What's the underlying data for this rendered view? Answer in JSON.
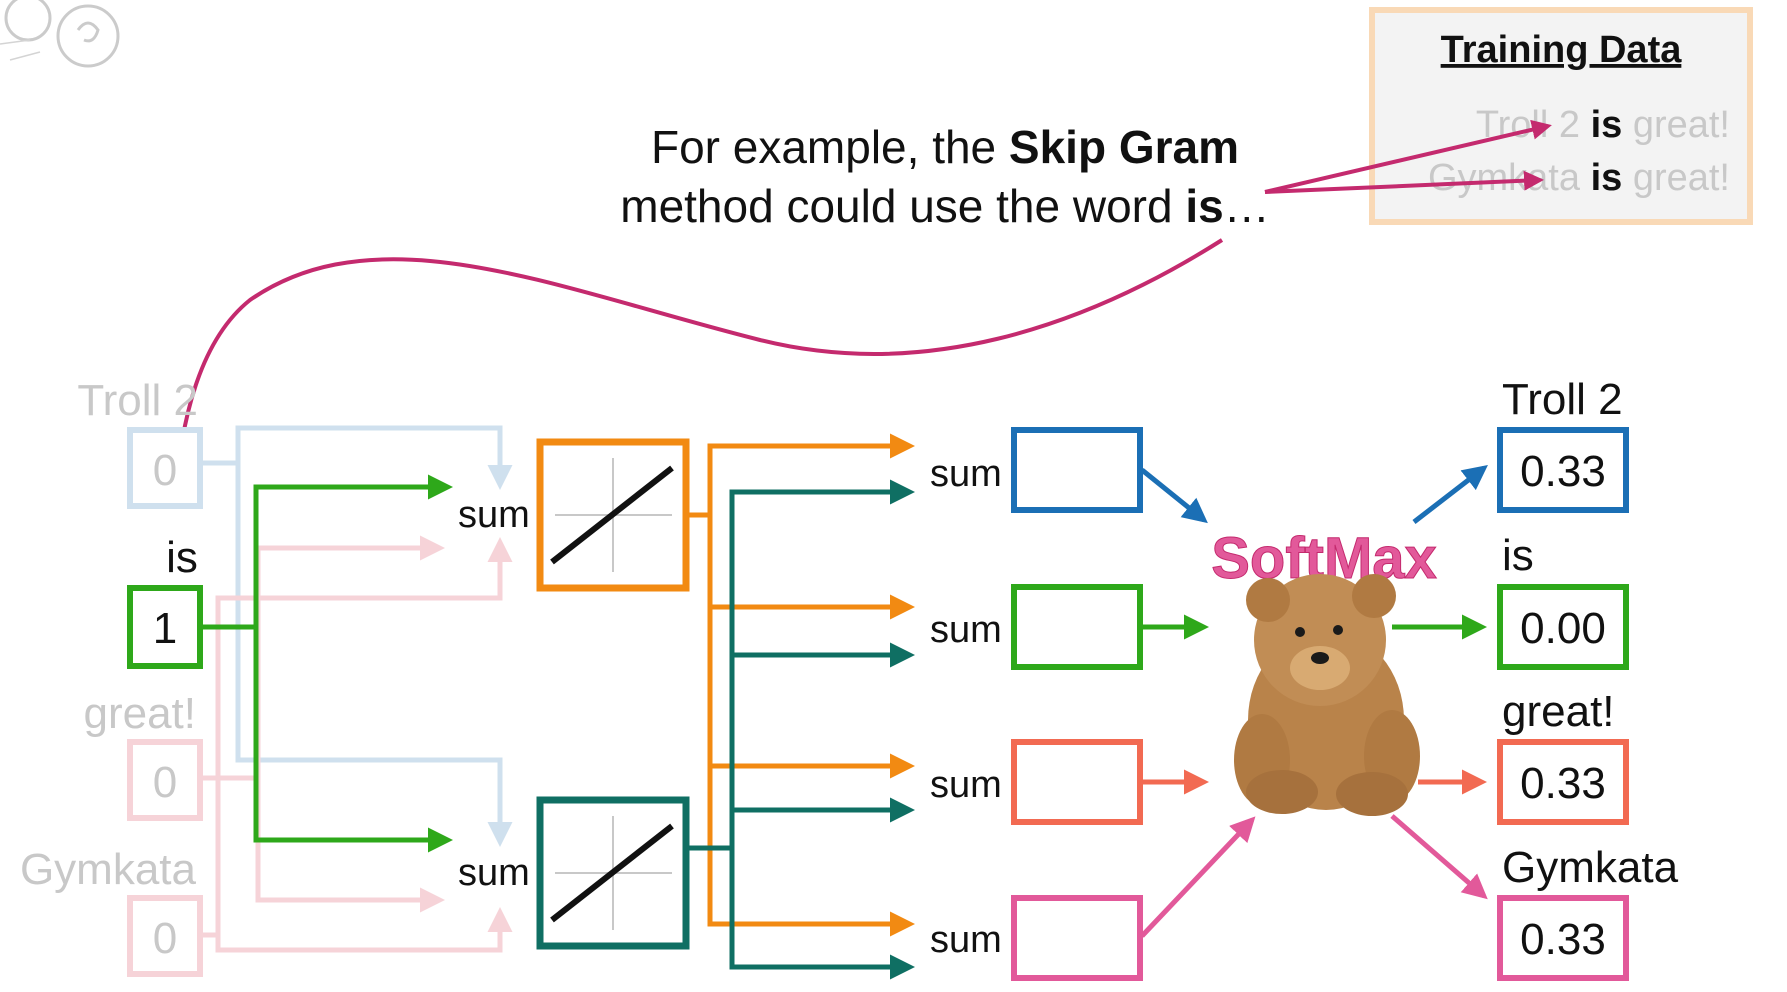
{
  "caption": {
    "line1_pre": "For example, the ",
    "line1_bold": "Skip Gram",
    "line2_pre": "method could use the word ",
    "line2_bold": "is",
    "line2_post": "…"
  },
  "training_data": {
    "title": "Training Data",
    "rows": [
      {
        "pre": "Troll 2 ",
        "bold": "is",
        "post": " great!"
      },
      {
        "pre": "Gymkata ",
        "bold": "is",
        "post": " great!"
      }
    ]
  },
  "inputs": [
    {
      "label": "Troll 2",
      "value": "0",
      "active": false
    },
    {
      "label": "is",
      "value": "1",
      "active": true
    },
    {
      "label": "great!",
      "value": "0",
      "active": false
    },
    {
      "label": "Gymkata",
      "value": "0",
      "active": false
    }
  ],
  "hidden_sum_label": "sum",
  "output_sum_label": "sum",
  "softmax_label": "SoftMax",
  "outputs": [
    {
      "label": "Troll 2",
      "value": "0.33",
      "color": "#1b6fb5"
    },
    {
      "label": "is",
      "value": "0.00",
      "color": "#2ea81a"
    },
    {
      "label": "great!",
      "value": "0.33",
      "color": "#f26a52"
    },
    {
      "label": "Gymkata",
      "value": "0.33",
      "color": "#e2599a"
    }
  ],
  "colors": {
    "accent": "#c42a6e",
    "green": "#2ea81a",
    "orange": "#f28a12",
    "teal": "#0f6f63",
    "faded_blue": "#cfe0ee",
    "faded_pink": "#f6d3d8",
    "faded_text": "#c8c8c8"
  }
}
